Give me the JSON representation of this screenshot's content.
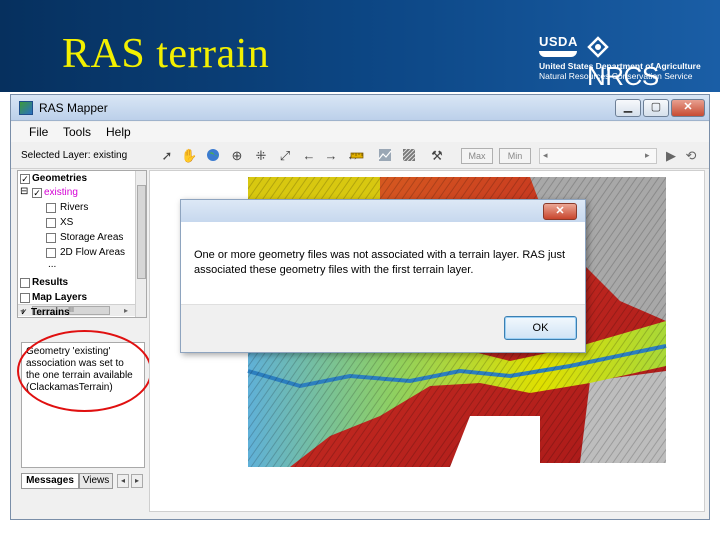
{
  "slide": {
    "title": "RAS terrain"
  },
  "logo": {
    "usda": "USDA",
    "nrcs": "NRCS",
    "dept": "United States Department of Agriculture",
    "service": "Natural Resources Conservation Service"
  },
  "window": {
    "title": "RAS Mapper",
    "controls": {
      "minimize": "▁",
      "maximize": "▢",
      "close": "✕"
    }
  },
  "menu": [
    "File",
    "Tools",
    "Help"
  ],
  "toolbar": {
    "selected_layer": "Selected Layer: existing",
    "max_label": "Max",
    "min_label": "Min",
    "icons": [
      "select-arrow-icon",
      "pan-hand-icon",
      "globe-icon",
      "zoom-in-icon",
      "zoom-extent-icon",
      "full-extent-icon",
      "back-arrow-icon",
      "forward-arrow-icon",
      "measure-icon",
      "ruler-icon",
      "profile-icon",
      "hatch-icon",
      "tools-icon",
      "play-icon",
      "reset-icon"
    ]
  },
  "tree": {
    "items": [
      {
        "label": "Geometries",
        "checked": true,
        "bold": true,
        "level": 0,
        "expander": ""
      },
      {
        "label": "existing",
        "checked": true,
        "bold": false,
        "level": 1,
        "expander": "⊟",
        "color": "#d400d4"
      },
      {
        "label": "Rivers",
        "checked": false,
        "level": 2
      },
      {
        "label": "XS",
        "checked": false,
        "level": 2
      },
      {
        "label": "Storage Areas",
        "checked": false,
        "level": 2
      },
      {
        "label": "2D Flow Areas",
        "checked": false,
        "level": 2
      },
      {
        "label": "...",
        "level": 2
      },
      {
        "label": "Results",
        "checked": false,
        "bold": true,
        "level": 0
      },
      {
        "label": "Map Layers",
        "checked": false,
        "bold": true,
        "level": 0
      },
      {
        "label": "Terrains",
        "checked": true,
        "bold": true,
        "level": 0
      }
    ],
    "hscroll_thumb": "III"
  },
  "messages": {
    "text": "Geometry 'existing' association was set to the one terrain available (ClackamasTerrain)"
  },
  "panel_tabs": [
    "Messages",
    "Views"
  ],
  "dialog": {
    "close_glyph": "✕",
    "message": "One or more geometry files was not associated with a terrain layer. RAS just associated these geometry files with the first terrain layer.",
    "ok_label": "OK"
  },
  "colors": {
    "header_bg": "#0d4887",
    "title_yellow": "#f3f000",
    "annotation_red": "#e01010",
    "terrain_low": "#3aa0d0",
    "terrain_mid": "#e8e000",
    "terrain_high": "#c02020"
  }
}
